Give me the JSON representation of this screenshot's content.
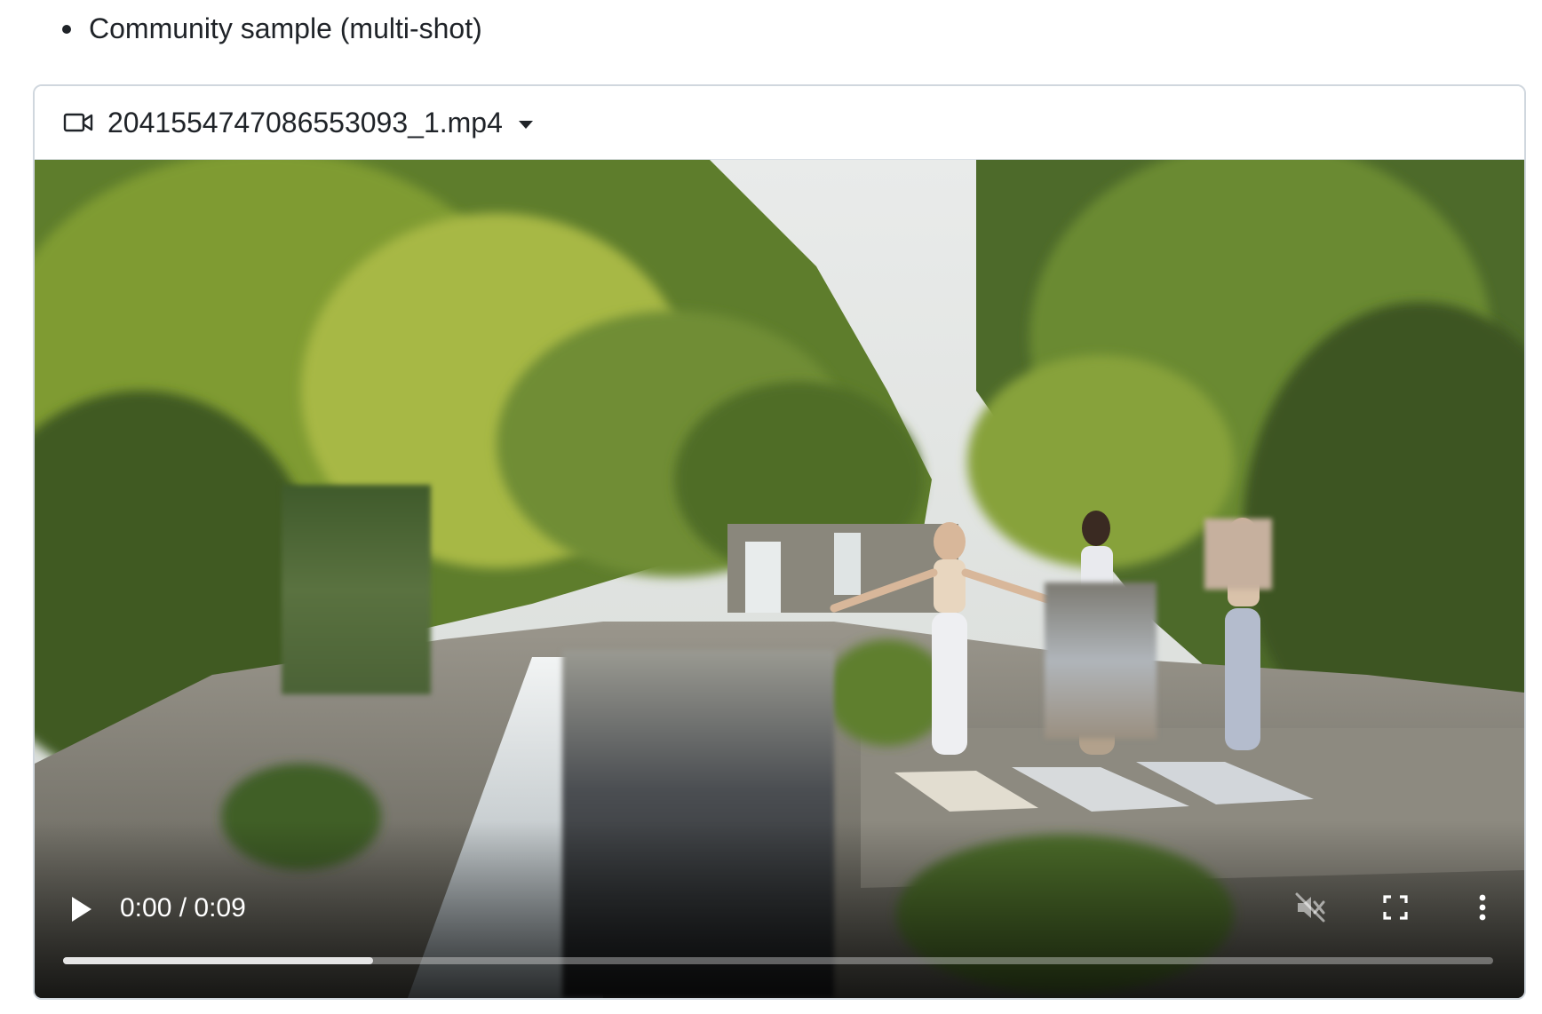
{
  "list": {
    "item_label": "Community sample (multi-shot)"
  },
  "video": {
    "file_name": "2041554747086553093_1.mp4",
    "header_icon": "video-camera-icon",
    "dropdown_icon": "caret-down-icon",
    "current_time": "0:00",
    "duration": "0:09",
    "time_separator": " / ",
    "time_text": "0:00 / 0:09",
    "progress_fraction": 0.217,
    "muted": true,
    "controls": {
      "play_icon": "play-icon",
      "mute_icon": "muted-speaker-icon",
      "fullscreen_icon": "fullscreen-icon",
      "more_icon": "more-options-icon"
    }
  },
  "colors": {
    "text": "#1f2328",
    "border": "#d0d7de",
    "controls": "#ffffff"
  }
}
